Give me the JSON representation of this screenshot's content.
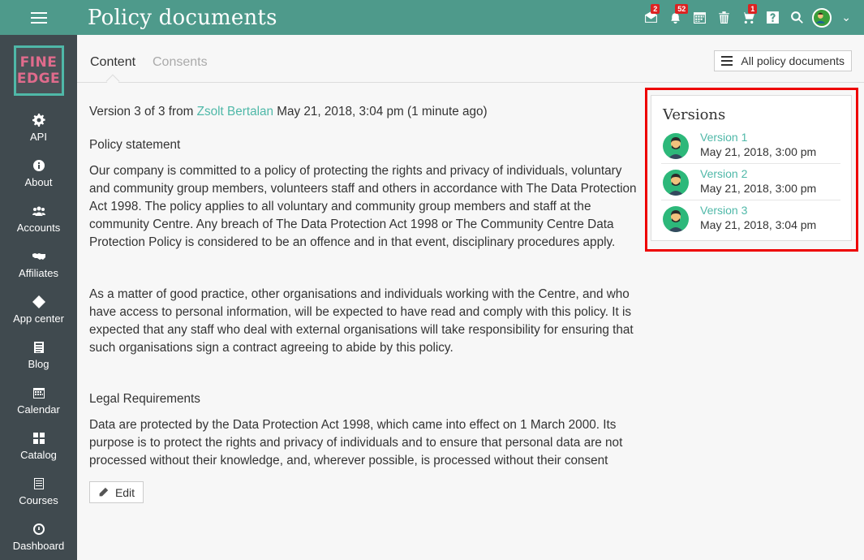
{
  "header": {
    "title": "Policy documents"
  },
  "top_icons": [
    {
      "name": "messages-icon",
      "badge": "2"
    },
    {
      "name": "notifications-icon",
      "badge": "52"
    },
    {
      "name": "calendar-icon",
      "badge": ""
    },
    {
      "name": "trash-icon",
      "badge": ""
    },
    {
      "name": "cart-icon",
      "badge": "1"
    },
    {
      "name": "help-icon",
      "badge": ""
    },
    {
      "name": "search-icon",
      "badge": ""
    }
  ],
  "logo": {
    "line1": "FINE",
    "line2": "EDGE"
  },
  "sidebar": {
    "items": [
      {
        "label": "API",
        "icon": "gear-icon"
      },
      {
        "label": "About",
        "icon": "info-icon"
      },
      {
        "label": "Accounts",
        "icon": "users-icon"
      },
      {
        "label": "Affiliates",
        "icon": "handshake-icon"
      },
      {
        "label": "App center",
        "icon": "apps-icon"
      },
      {
        "label": "Blog",
        "icon": "blog-icon"
      },
      {
        "label": "Calendar",
        "icon": "calendar-icon"
      },
      {
        "label": "Catalog",
        "icon": "grid-icon"
      },
      {
        "label": "Courses",
        "icon": "courses-icon"
      },
      {
        "label": "Dashboard",
        "icon": "dashboard-icon"
      }
    ]
  },
  "tabs": {
    "content": "Content",
    "consents": "Consents",
    "all_docs": "All policy documents"
  },
  "document": {
    "version_prefix": "Version 3 of 3 from",
    "author": "Zsolt Bertalan",
    "version_suffix": "May 21, 2018, 3:04 pm (1 minute ago)",
    "section1_title": "Policy statement",
    "section1_para1": "Our company is committed to a policy of protecting the rights and privacy of individuals, voluntary and community group members, volunteers staff and others in accordance with The Data Protection Act 1998. The policy applies to all voluntary and community group members and staff at the community Centre. Any breach of The Data Protection Act 1998 or The Community Centre Data Protection Policy is considered to be an offence and in that event, disciplinary procedures apply.",
    "section1_para2": "As a matter of good practice, other organisations and individuals working with the Centre, and who have access to personal information, will be expected to have read and comply with this policy. It is expected that any staff who deal with external organisations will take responsibility for ensuring that such organisations sign a contract agreeing to abide by this policy.",
    "section2_title": "Legal Requirements",
    "section2_para": "Data are protected by the Data Protection Act 1998, which came into effect on 1 March 2000. Its purpose is to protect the rights and privacy of individuals and to ensure that personal data are not processed without their knowledge, and, wherever possible, is processed without their consent",
    "edit_label": "Edit"
  },
  "versions": {
    "title": "Versions",
    "items": [
      {
        "label": "Version 1",
        "date": "May 21, 2018, 3:00 pm"
      },
      {
        "label": "Version 2",
        "date": "May 21, 2018, 3:00 pm"
      },
      {
        "label": "Version 3",
        "date": "May 21, 2018, 3:04 pm"
      }
    ]
  },
  "colors": {
    "accent": "#4e9a8b",
    "link": "#4fb8a8",
    "sidebar": "#404a4f",
    "highlight": "#e00000"
  }
}
